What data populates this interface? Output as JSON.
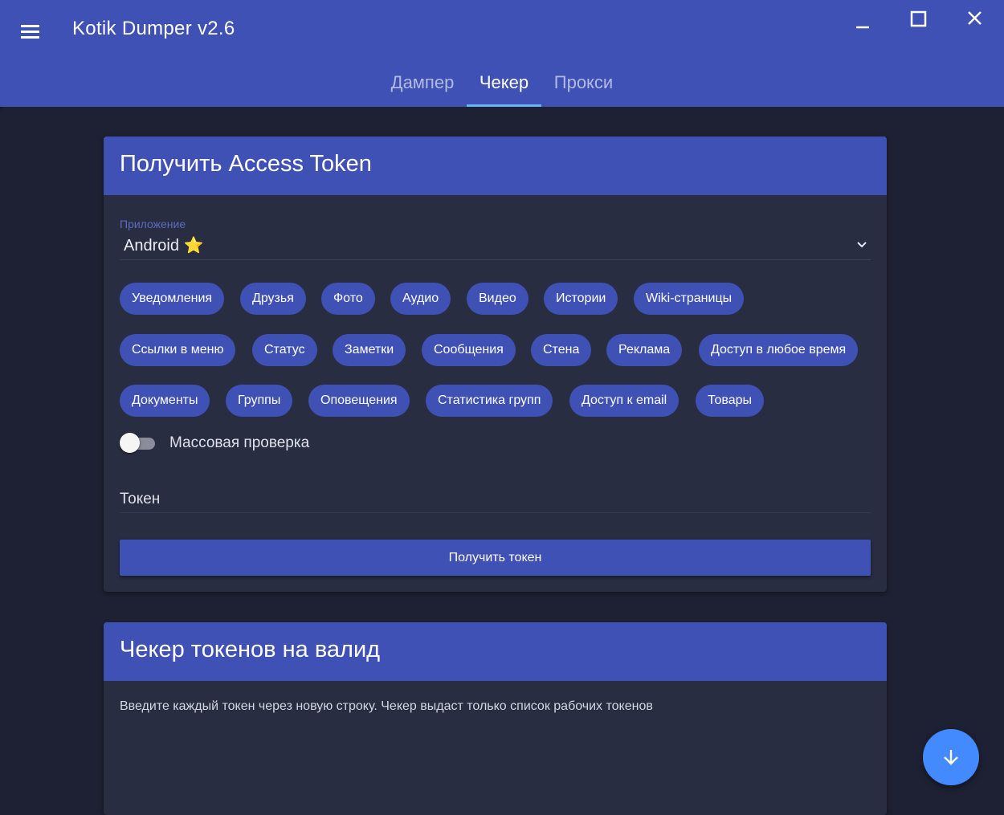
{
  "window": {
    "title": "Kotik Dumper v2.6"
  },
  "tabs": [
    {
      "label": "Дампер",
      "active": false
    },
    {
      "label": "Чекер",
      "active": true
    },
    {
      "label": "Прокси",
      "active": false
    }
  ],
  "token_card": {
    "title": "Получить Access Token",
    "app_select": {
      "label": "Приложение",
      "value": "Android",
      "value_icon": "⭐"
    },
    "permissions": [
      "Уведомления",
      "Друзья",
      "Фото",
      "Аудио",
      "Видео",
      "Истории",
      "Wiki-страницы",
      "Ссылки в меню",
      "Статус",
      "Заметки",
      "Сообщения",
      "Стена",
      "Реклама",
      "Доступ в любое время",
      "Документы",
      "Группы",
      "Оповещения",
      "Статистика групп",
      "Доступ к email",
      "Товары"
    ],
    "mass_check": {
      "label": "Массовая проверка",
      "enabled": false
    },
    "token_input": {
      "placeholder": "Токен",
      "value": ""
    },
    "submit_label": "Получить токен"
  },
  "checker_card": {
    "title": "Чекер токенов на валид",
    "hint": "Введите каждый токен через новую строку. Чекер выдаст только список рабочих токенов"
  },
  "fab": {
    "icon": "arrow-down-icon"
  },
  "colors": {
    "primary": "#3f51b5",
    "background": "#1e2133",
    "card": "#292d42",
    "fab": "#448aff",
    "tab_indicator": "#64b5f6"
  }
}
